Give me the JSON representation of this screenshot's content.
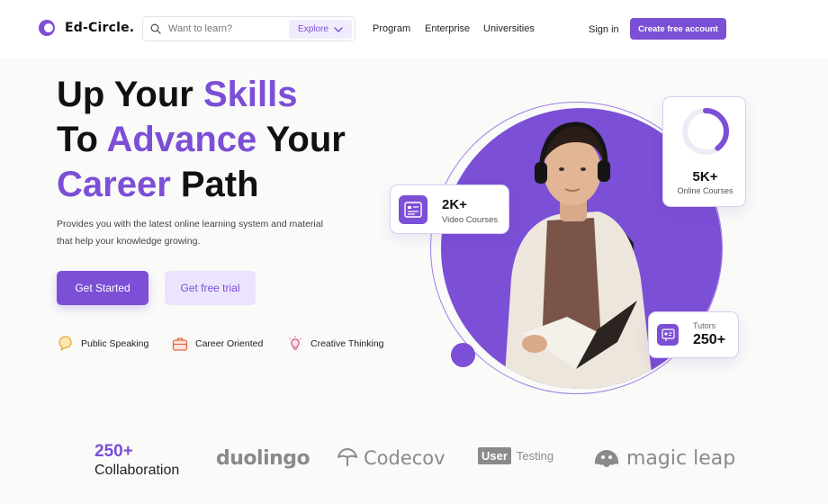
{
  "nav": {
    "brand": "Ed-Circle.",
    "search_placeholder": "Want to learn?",
    "explore_label": "Explore",
    "links": [
      "Program",
      "Enterprise",
      "Universities"
    ],
    "signin": "Sign in",
    "create_account": "Create free account"
  },
  "hero": {
    "line1_a": "Up Your ",
    "line1_b": "Skills",
    "line2_a": "To ",
    "line2_b": "Advance",
    "line2_c": " Your",
    "line3_a": "Career",
    "line3_b": " Path",
    "description": "Provides you with the latest online learning system and material that help your knowledge growing.",
    "btn_start": "Get Started",
    "btn_trial": "Get free trial",
    "features": [
      "Public Speaking",
      "Career Oriented",
      "Creative Thinking"
    ]
  },
  "stats": {
    "video_num": "2K+",
    "video_label": "Video Courses",
    "online_num": "5K+",
    "online_label": "Online Courses",
    "online_progress": 0.4,
    "tutors_label": "Tutors",
    "tutors_num": "250+"
  },
  "collab": {
    "num": "250+",
    "label": "Collaboration",
    "partners": [
      "duolingo",
      "Codecov",
      "User",
      "Testing",
      "magic leap"
    ]
  },
  "colors": {
    "accent": "#7b4fd6",
    "accent_light": "#ece4fc",
    "partner_gray": "#8a8a8a"
  },
  "icons": [
    "search-icon",
    "chevron-down-icon",
    "video-course-icon",
    "tutor-icon",
    "speech-bubble-icon",
    "briefcase-icon",
    "lightbulb-icon",
    "codecov-umbrella-icon",
    "magicleap-blob-icon"
  ]
}
